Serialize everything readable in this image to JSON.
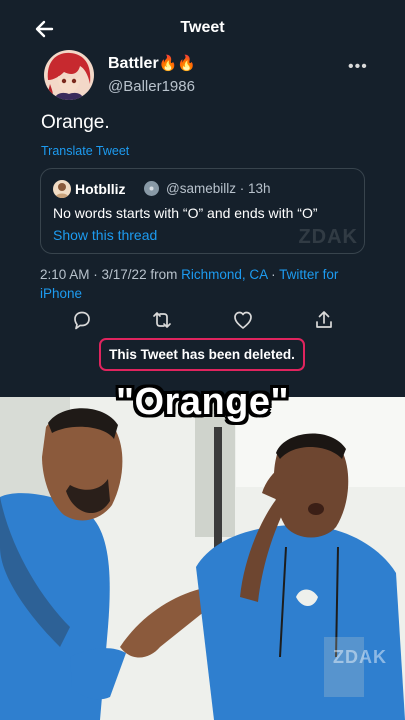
{
  "header": {
    "title": "Tweet",
    "back_icon": "back-arrow-icon"
  },
  "author": {
    "display_name": "Battler",
    "emoji": "🔥🔥",
    "handle": "@Baller1986"
  },
  "tweet": {
    "text": "Orange.",
    "translate_label": "Translate Tweet"
  },
  "quote": {
    "name": "Hotblliz",
    "handle": "@samebillz",
    "time": "13h",
    "text": "No words starts with “O” and ends with “O”",
    "show_thread_label": "Show this thread",
    "watermark": "ZDAK"
  },
  "meta": {
    "time": "2:10 AM",
    "date": "3/17/22",
    "from_label": "from",
    "location": "Richmond, CA",
    "source": "Twitter for iPhone"
  },
  "actions": [
    "reply-icon",
    "retweet-icon",
    "like-icon",
    "share-icon"
  ],
  "deleted_notice": "This Tweet has been deleted.",
  "caption": "\"Orange\"",
  "photo_watermark": "ZDAK",
  "colors": {
    "background": "#15202b",
    "link": "#1d9bf0",
    "muted": "#b8c2cc",
    "alert": "#e0245e"
  }
}
